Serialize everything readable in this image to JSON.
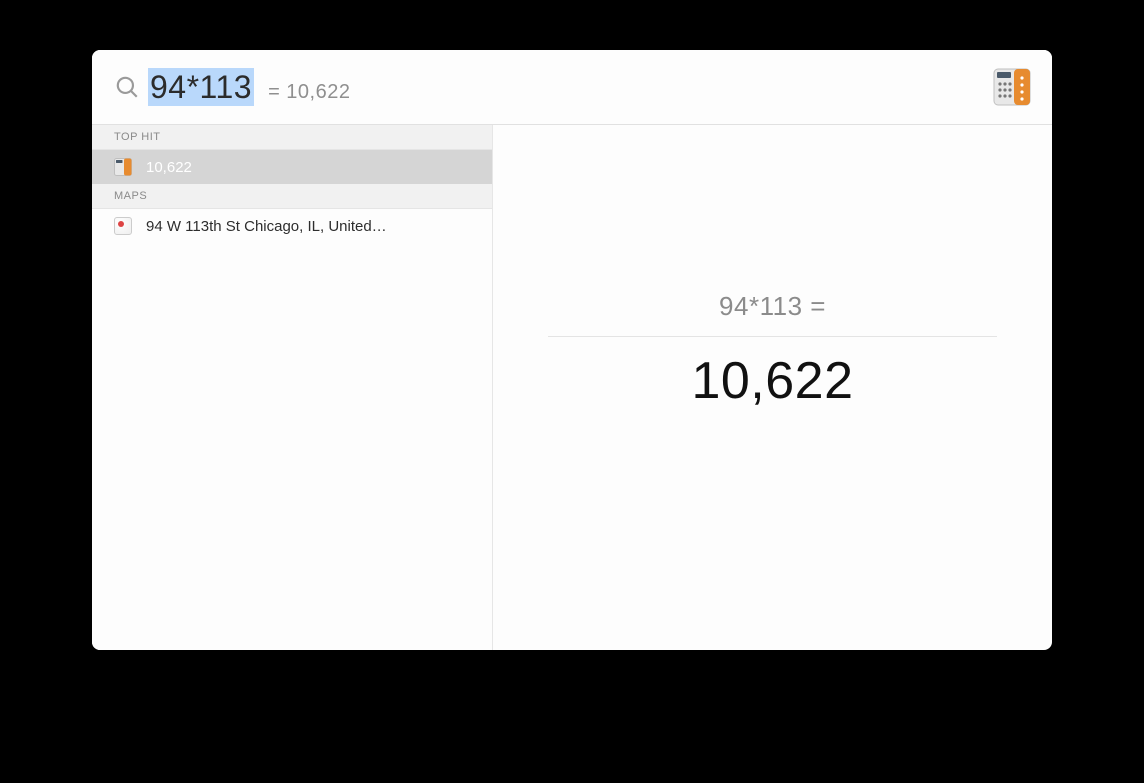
{
  "search": {
    "query": "94*113",
    "inline_result": "=  10,622"
  },
  "header_icon": "calculator-icon",
  "sections": [
    {
      "title": "TOP HIT",
      "items": [
        {
          "icon": "calculator-icon",
          "label": "10,622",
          "selected": true
        }
      ]
    },
    {
      "title": "MAPS",
      "items": [
        {
          "icon": "maps-icon",
          "label": "94 W 113th St Chicago, IL, United…",
          "selected": false
        }
      ]
    }
  ],
  "detail": {
    "expression": "94*113 =",
    "result": "10,622"
  }
}
